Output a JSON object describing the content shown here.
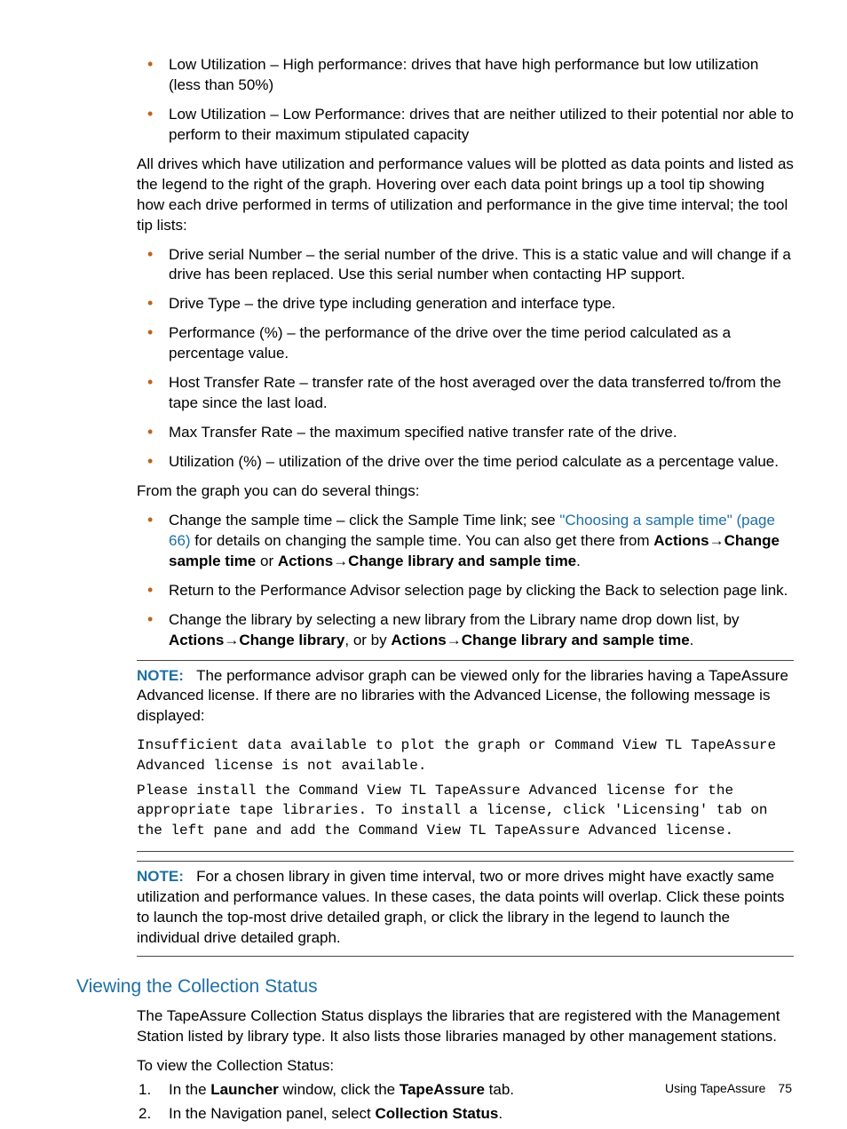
{
  "list1": [
    "Low Utilization – High performance: drives that have high performance but low utilization (less than 50%)",
    "Low Utilization – Low Performance: drives that are neither utilized to their potential nor able to perform to their maximum stipulated capacity"
  ],
  "para1": "All drives which have utilization and performance values will be plotted as data points and listed as the legend to the right of the graph. Hovering over each data point brings up a tool tip showing how each drive performed in terms of utilization and performance in the give time interval; the tool tip lists:",
  "list2": [
    "Drive serial Number – the serial number of the drive. This is a static value and will change if a drive has been replaced. Use this serial number when contacting HP support.",
    "Drive Type – the drive type including generation and interface type.",
    "Performance (%) – the performance of the drive over the time period calculated as a percentage value.",
    "Host Transfer Rate – transfer rate of the host averaged over the data transferred to/from the tape since the last load.",
    "Max Transfer Rate – the maximum specified native transfer rate of the drive.",
    "Utilization (%) – utilization of the drive over the time period calculate as a percentage value."
  ],
  "para2": "From the graph you can do several things:",
  "list3_item1_pre": "Change the sample time – click the Sample Time link; see ",
  "list3_item1_link": "\"Choosing a sample time\" (page 66)",
  "list3_item1_post1": " for details on changing the sample time. You can also get there from ",
  "list3_item1_b1": "Actions",
  "list3_item1_arrow": "→",
  "list3_item1_b2": "Change sample time",
  "list3_item1_or": " or ",
  "list3_item1_b3": "Actions",
  "list3_item1_b4": "Change library and sample time",
  "list3_item1_end": ".",
  "list3_item2": "Return to the Performance Advisor selection page by clicking the Back to selection page link.",
  "list3_item3_pre": "Change the library by selecting a new library from the Library name drop down list, by ",
  "list3_item3_b1": "Actions",
  "list3_item3_b2": "Change library",
  "list3_item3_mid": ", or by ",
  "list3_item3_b3": "Actions",
  "list3_item3_b4": "Change library and sample time",
  "list3_item3_end": ".",
  "note1_label": "NOTE:",
  "note1_body": "The performance advisor graph can be viewed only for the libraries having a TapeAssure Advanced license. If there are no libraries with the Advanced License, the following message is displayed:",
  "note1_mono1": "Insufficient data available to plot the graph or Command View TL TapeAssure Advanced license is not available.",
  "note1_mono2": "Please install the Command View TL TapeAssure Advanced license for the appropriate tape libraries. To install a license, click 'Licensing' tab on the left pane and add the Command View TL TapeAssure Advanced license.",
  "note2_label": "NOTE:",
  "note2_body": "For a chosen library in given time interval, two or more drives might have exactly same utilization and performance values. In these cases, the data points will overlap. Click these points to launch the top-most drive detailed graph, or click the library in the legend to launch the individual drive detailed graph.",
  "section_heading": "Viewing the Collection Status",
  "section_p1": "The TapeAssure Collection Status displays the libraries that are registered with the Management Station listed by library type. It also lists those libraries managed by other management stations.",
  "section_p2": "To view the Collection Status:",
  "step1_pre": "In the ",
  "step1_b1": "Launcher",
  "step1_mid": " window, click the ",
  "step1_b2": "TapeAssure",
  "step1_post": " tab.",
  "step2_pre": "In the Navigation panel, select ",
  "step2_b1": "Collection Status",
  "step2_post": ".",
  "footer_text": "Using TapeAssure",
  "footer_page": "75"
}
